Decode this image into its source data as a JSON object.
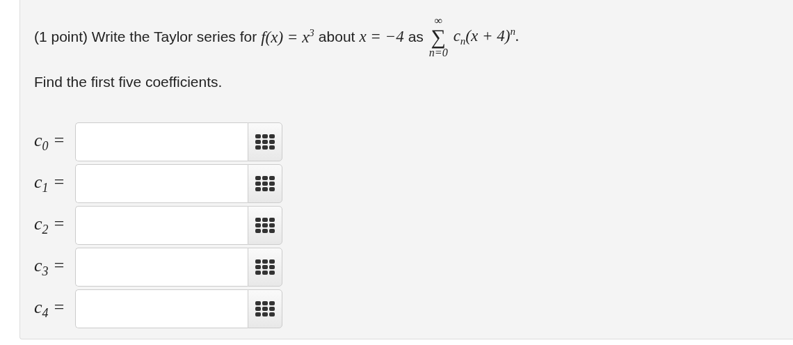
{
  "question": {
    "parts": [
      {
        "kind": "text",
        "text": "(1 point) Write the Taylor series for"
      },
      {
        "kind": "math",
        "text": "f(x) = x$^{3}$"
      },
      {
        "kind": "text",
        "text": "about"
      },
      {
        "kind": "math",
        "text": "x = −4"
      },
      {
        "kind": "text",
        "text": "as"
      },
      {
        "kind": "sum",
        "symbol": "∑",
        "upper": "∞",
        "lower": "n=0"
      },
      {
        "kind": "math",
        "text": "c$_{n}$(x + 4)$^{n}$."
      }
    ]
  },
  "instruction": "Find the first five coefficients.",
  "answers": [
    {
      "label": "c$_{0}$ ="
    },
    {
      "label": "c$_{1}$ ="
    },
    {
      "label": "c$_{2}$ ="
    },
    {
      "label": "c$_{3}$ ="
    },
    {
      "label": "c$_{4}$ ="
    }
  ]
}
